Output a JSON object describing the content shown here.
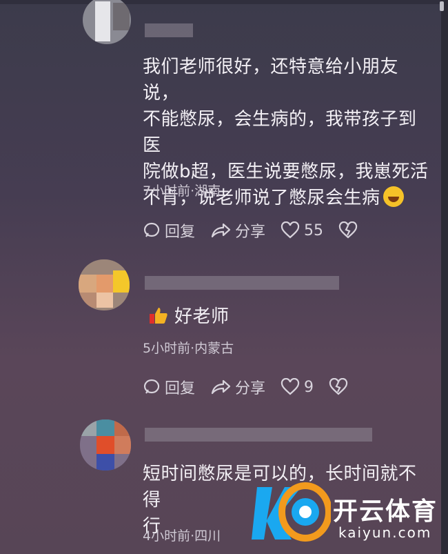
{
  "comments": [
    {
      "text": "我们老师很好，还特意给小朋友说，不能憋尿，会生病的，我带孩子到医院做b超，医生说要憋尿，我崽死活不肯，说老师说了憋尿会生病",
      "line1": "我们老师很好，还特意给小朋友说，",
      "line2": "不能憋尿，会生病的，我带孩子到医",
      "line3": "院做b超，医生说要憋尿，我崽死活",
      "line4": "不肯，说老师说了憋尿会生病",
      "meta": "7小时前·湖南",
      "reply_label": "回复",
      "share_label": "分享",
      "likes": "55"
    },
    {
      "text": "好老师",
      "meta": "5小时前·内蒙古",
      "reply_label": "回复",
      "share_label": "分享",
      "likes": "9"
    },
    {
      "line1": "短时间憋尿是可以的，长时间就不得",
      "line2": "行",
      "meta": "4小时前·四川"
    }
  ],
  "watermark": {
    "name": "开云体育",
    "url": "kaiyun.com"
  },
  "colors": {
    "brand_blue": "#1aa8f0",
    "brand_orange": "#f29a1d"
  }
}
